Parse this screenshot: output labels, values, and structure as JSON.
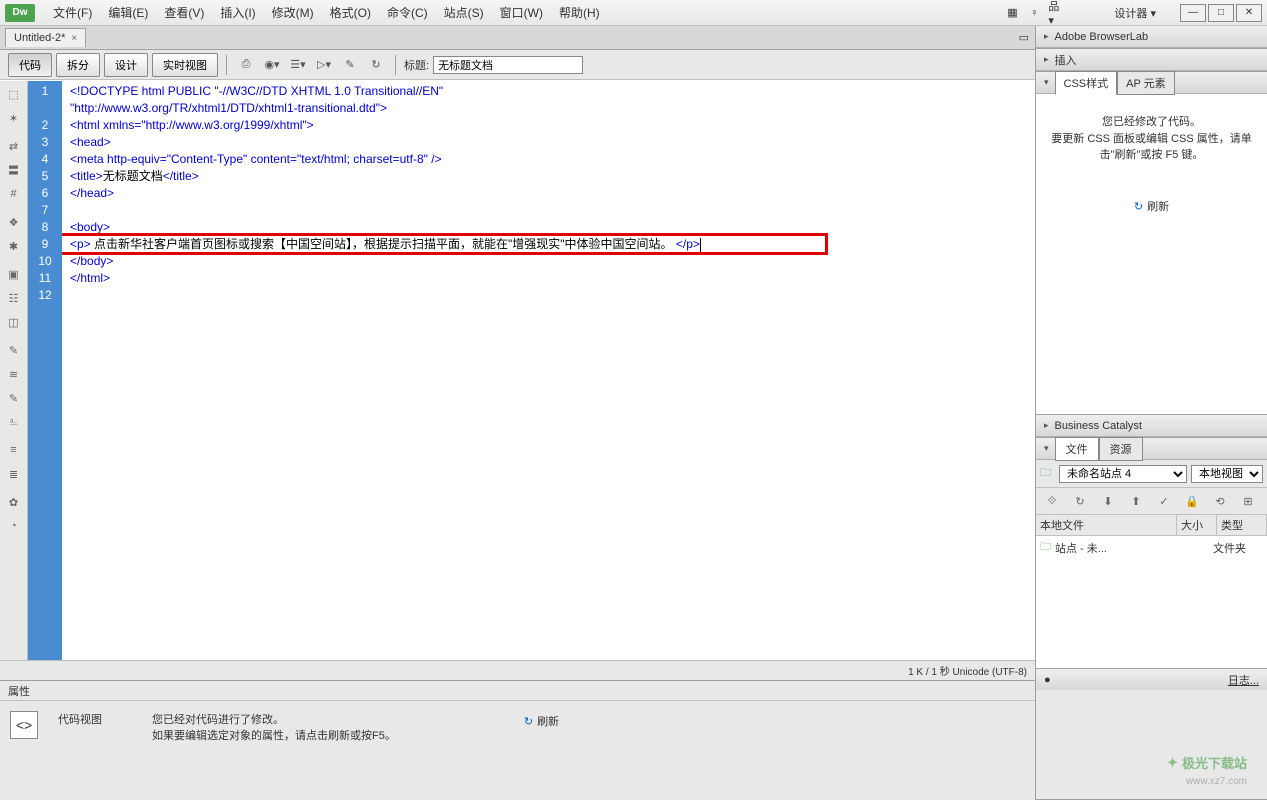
{
  "logo": "Dw",
  "menu": [
    "文件(F)",
    "编辑(E)",
    "查看(V)",
    "插入(I)",
    "修改(M)",
    "格式(O)",
    "命令(C)",
    "站点(S)",
    "窗口(W)",
    "帮助(H)"
  ],
  "topRight": {
    "designer": "设计器",
    "dropdown": "▾"
  },
  "docTab": {
    "name": "Untitled-2*",
    "close": "×"
  },
  "toolbar": {
    "code": "代码",
    "split": "拆分",
    "design": "设计",
    "live": "实时视图",
    "titleLabel": "标题:",
    "titleValue": "无标题文档"
  },
  "code": {
    "lines": [
      {
        "n": 1,
        "seg": [
          [
            "<!DOCTYPE html PUBLIC \"-//W3C//DTD XHTML 1.0 Transitional//EN\"",
            "c-blue"
          ]
        ]
      },
      {
        "n": 0,
        "seg": [
          [
            "\"http://www.w3.org/TR/xhtml1/DTD/xhtml1-transitional.dtd\">",
            "c-blue"
          ]
        ]
      },
      {
        "n": 2,
        "seg": [
          [
            "<html xmlns=\"http://www.w3.org/1999/xhtml\">",
            "c-blue"
          ]
        ]
      },
      {
        "n": 3,
        "seg": [
          [
            "<head>",
            "c-blue"
          ]
        ]
      },
      {
        "n": 4,
        "seg": [
          [
            "<meta http-equiv=\"Content-Type\" content=\"text/html; charset=utf-8\" />",
            "c-blue"
          ]
        ]
      },
      {
        "n": 5,
        "seg": [
          [
            "<title>",
            "c-blue"
          ],
          [
            "无标题文档",
            "c-black"
          ],
          [
            "</title>",
            "c-blue"
          ]
        ]
      },
      {
        "n": 6,
        "seg": [
          [
            "</head>",
            "c-blue"
          ]
        ]
      },
      {
        "n": 7,
        "seg": [
          [
            "",
            "c-black"
          ]
        ]
      },
      {
        "n": 8,
        "seg": [
          [
            "<body>",
            "c-blue"
          ]
        ]
      },
      {
        "n": 9,
        "seg": [
          [
            "<p>",
            "c-blue"
          ],
          [
            " 点击新华社客户端首页图标或搜索【中国空间站】，根据提示扫描平面，就能在\"增强现实\"中体验中国空间站。 ",
            "c-black"
          ],
          [
            "</p>",
            "c-blue"
          ]
        ],
        "hl": true
      },
      {
        "n": 10,
        "seg": [
          [
            "</body>",
            "c-blue"
          ]
        ]
      },
      {
        "n": 11,
        "seg": [
          [
            "</html>",
            "c-blue"
          ]
        ]
      },
      {
        "n": 12,
        "seg": [
          [
            "",
            "c-black"
          ]
        ]
      }
    ]
  },
  "statusLine": "1 K / 1 秒 Unicode (UTF-8)",
  "properties": {
    "header": "属性",
    "codeViewLabel": "代码视图",
    "msg1": "您已经对代码进行了修改。",
    "msg2": "如果要编辑选定对象的属性，请点击刷新或按F5。",
    "refresh": "刷新"
  },
  "rightPanels": {
    "browserLab": "Adobe BrowserLab",
    "insert": "插入",
    "cssStyles": "CSS样式",
    "apElements": "AP 元素",
    "cssMsg1": "您已经修改了代码。",
    "cssMsg2": "要更新 CSS 面板或编辑 CSS 属性，请单击\"刷新\"或按 F5 键。",
    "refresh": "刷新",
    "businessCatalyst": "Business Catalyst",
    "fileTab": "文件",
    "resourceTab": "资源",
    "siteSelect": "未命名站点 4",
    "viewSelect": "本地视图",
    "ftHeader1": "本地文件",
    "ftHeader2": "大小",
    "ftHeader3": "类型",
    "fileRow": {
      "name": "站点 - 未...",
      "type": "文件夹"
    },
    "logLabel": "日志..."
  },
  "watermark": "极光下载站",
  "watermarkUrl": "www.xz7.com"
}
